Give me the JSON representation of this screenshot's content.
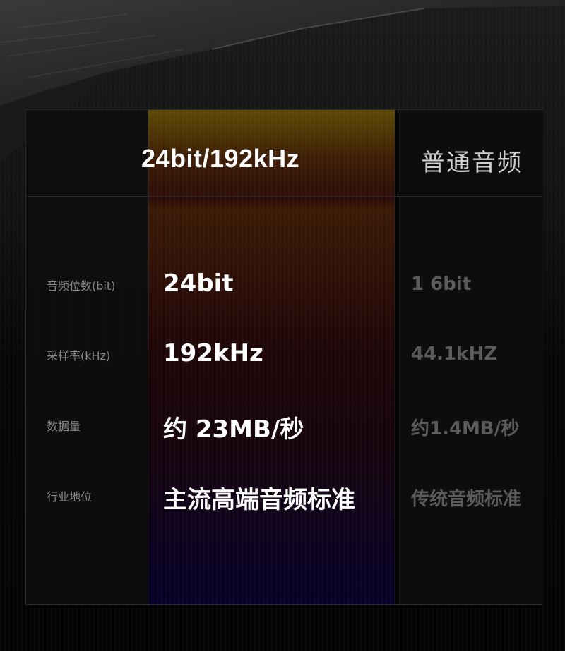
{
  "header": {
    "highlight_column": "24bit/192kHz",
    "standard_column": "普通音频"
  },
  "rows": [
    {
      "label": "音频位数(bit)",
      "highlight": "24bit",
      "standard": "1 6bit"
    },
    {
      "label": "采样率(kHz)",
      "highlight": "192kHz",
      "standard": "44.1kHZ"
    },
    {
      "label": "数据量",
      "highlight": "约 23MB/秒",
      "standard": "约1.4MB/秒"
    },
    {
      "label": "行业地位",
      "highlight": "主流高端音频标准",
      "standard": "传统音频标准"
    }
  ],
  "colors": {
    "background": "#060606",
    "highlight_text": "#ffffff",
    "standard_text": "#5b5b5b",
    "label_text": "#8a8a8a"
  }
}
